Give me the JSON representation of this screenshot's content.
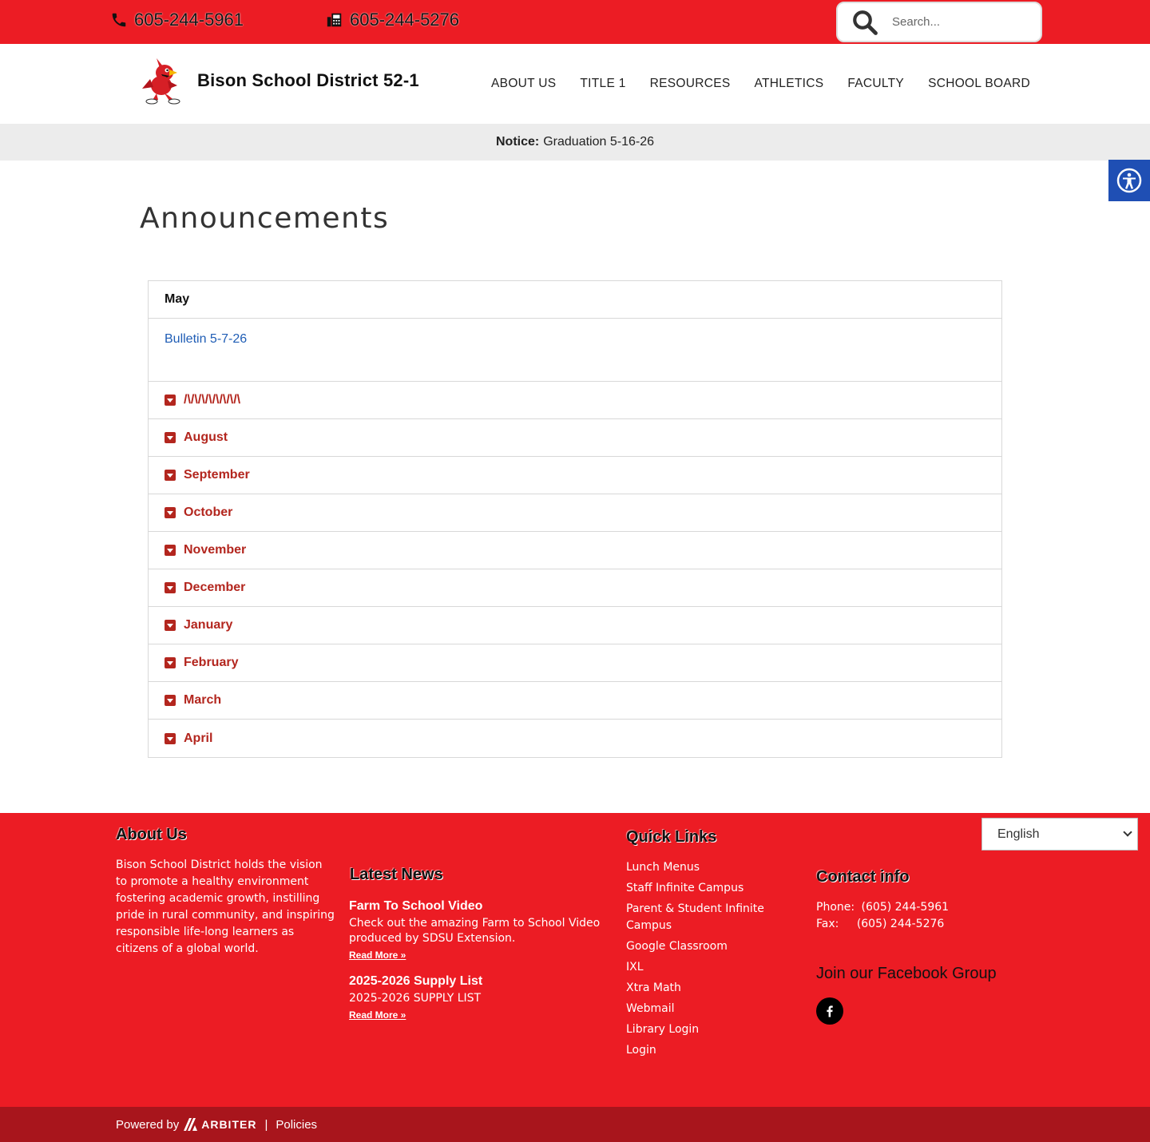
{
  "topbar": {
    "phone": "605-244-5961",
    "fax": "605-244-5276",
    "search_placeholder": "Search..."
  },
  "header": {
    "site_title": "Bison School District 52-1",
    "nav": [
      "ABOUT US",
      "TITLE 1",
      "RESOURCES",
      "ATHLETICS",
      "FACULTY",
      "SCHOOL BOARD"
    ]
  },
  "notice": {
    "label": "Notice:",
    "text": "Graduation 5-16-26"
  },
  "page": {
    "title": "Announcements"
  },
  "accordion": {
    "open_section": "May",
    "open_link": "Bulletin 5-7-26",
    "sections": [
      "/\\/\\/\\/\\/\\/\\/\\/\\",
      "August",
      "September",
      "October",
      "November",
      "December",
      "January",
      "February",
      "March",
      "April"
    ]
  },
  "footer": {
    "about_heading": "About Us",
    "about_text": "Bison School District holds the vision to promote a healthy environment fostering academic growth, instilling pride in rural community, and inspiring responsible life-long learners as citizens of a global world.",
    "news_heading": "Latest News",
    "news": [
      {
        "title": "Farm To School Video",
        "text": "Check out the amazing Farm to School Video produced by  SDSU Extension.",
        "more": "Read More »"
      },
      {
        "title": "2025-2026 Supply List",
        "text": "2025-2026 SUPPLY LIST",
        "more": "Read More »"
      }
    ],
    "quick_heading": "Quick Links",
    "quick_links": [
      "Lunch Menus",
      "Staff Infinite Campus",
      "Parent & Student Infinite Campus",
      "Google Classroom",
      "IXL",
      "Xtra Math",
      "Webmail",
      "Library Login",
      "Login"
    ],
    "language": "English",
    "contact_heading": "Contact info",
    "contact_phone_label": "Phone:",
    "contact_phone": "(605) 244-5961",
    "contact_fax_label": "Fax:",
    "contact_fax": "(605) 244-5276",
    "facebook_heading": "Join our Facebook Group"
  },
  "bottombar": {
    "powered": "Powered by",
    "brand": "ARBITER",
    "separator": "|",
    "policies": "Policies"
  },
  "colors": {
    "brand_red": "#ec1c24",
    "dark_red": "#a8151c",
    "accordion_red": "#b3261e",
    "link_blue": "#1f5db5",
    "a11y_blue": "#1f4fb4"
  }
}
